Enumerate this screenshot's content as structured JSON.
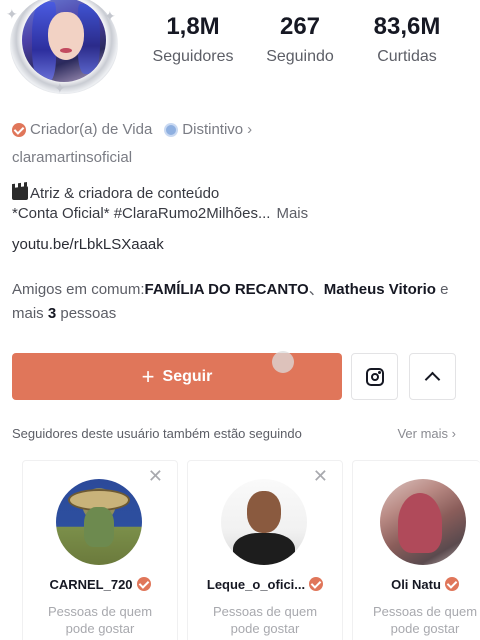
{
  "profile": {
    "stats": [
      {
        "value": "1,8M",
        "label": "Seguidores"
      },
      {
        "value": "267",
        "label": "Seguindo"
      },
      {
        "value": "83,6M",
        "label": "Curtidas"
      }
    ],
    "badges": {
      "creator": "Criador(a) de Vida",
      "distinct": "Distintivo"
    },
    "username": "claramartinsoficial",
    "bio": {
      "line1": "Atriz & criadora de conteúdo",
      "line2": "*Conta Oficial*  #ClaraRumo2Milhões...",
      "more": "Mais"
    },
    "link": "youtu.be/rLbkLSXaaak",
    "mutual": {
      "prefix": "Amigos em comum:",
      "friend1": "FAMÍLIA DO RECANTO",
      "sep": "、",
      "friend2": "Matheus Vitorio",
      "middle": " e mais ",
      "count": "3",
      "suffix": " pessoas"
    }
  },
  "actions": {
    "follow_label": "Seguir",
    "instagram_icon": "instagram-icon",
    "expand_icon": "chevron-up-icon"
  },
  "suggestions": {
    "header": "Seguidores deste usuário também estão seguindo",
    "see_more": "Ver mais",
    "cards": [
      {
        "name": "CARNEL_720",
        "sub_line1": "Pessoas de quem",
        "sub_line2": "pode gostar"
      },
      {
        "name": "Leque_o_ofici...",
        "sub_line1": "Pessoas de quem",
        "sub_line2": "pode gostar"
      },
      {
        "name": "Oli Natu",
        "sub_line1": "Pessoas de quem",
        "sub_line2": "pode gostar"
      }
    ]
  },
  "colors": {
    "accent": "#e0765a",
    "text_primary": "#161823",
    "text_secondary": "#7a7c84"
  }
}
